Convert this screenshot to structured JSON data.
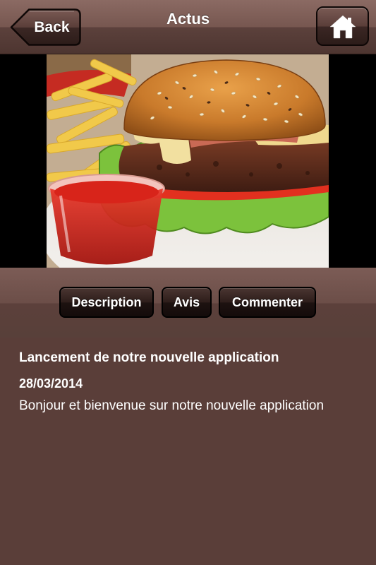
{
  "header": {
    "title": "Actus",
    "back_label": "Back",
    "home_icon": "home-icon"
  },
  "slider": {
    "photo": "burger-with-fries-and-ketchup",
    "page_index": 1,
    "page_count": 1,
    "social": [
      "facebook-icon",
      "twitter-icon"
    ]
  },
  "tabs": {
    "description": "Description",
    "avis": "Avis",
    "commenter": "Commenter",
    "selected": "Description"
  },
  "article": {
    "title": "Lancement de notre nouvelle application",
    "date": "28/03/2014",
    "body": "Bonjour et bienvenue sur notre nouvelle application"
  },
  "colors": {
    "background": "#5a3e39",
    "header": "#775750",
    "button_dark": "#1d1210",
    "text": "#ffffff"
  }
}
